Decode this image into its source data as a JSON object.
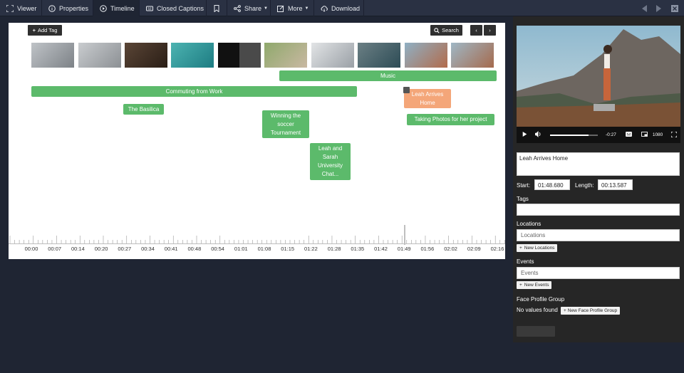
{
  "nav": {
    "tabs": [
      {
        "label": "Viewer",
        "icon": "viewer-icon"
      },
      {
        "label": "Properties",
        "icon": "info-icon"
      },
      {
        "label": "Timeline",
        "icon": "play-circle-icon"
      },
      {
        "label": "Closed Captions",
        "icon": "cc-icon"
      },
      {
        "label": "",
        "icon": "bookmark-icon"
      },
      {
        "label": "Share",
        "icon": "share-icon"
      },
      {
        "label": "More",
        "icon": "edit-icon"
      },
      {
        "label": "Download",
        "icon": "cloud-download-icon"
      }
    ],
    "active_tab": "Timeline"
  },
  "timeline": {
    "add_tag_label": "Add Tag",
    "search_label": "Search",
    "tags": [
      {
        "label": "Music",
        "color": "green"
      },
      {
        "label": "Commuting from Work",
        "color": "green"
      },
      {
        "label": "Leah Arrives Home",
        "color": "orange"
      },
      {
        "label": "The Basilica",
        "color": "green"
      },
      {
        "label": "Winning the soccer Tournament",
        "color": "green"
      },
      {
        "label": "Taking Photos for her project",
        "color": "green"
      },
      {
        "label": "Leah and Sarah University Chat...",
        "color": "green"
      }
    ],
    "ticks": [
      "00:00",
      "00:07",
      "00:14",
      "00:20",
      "00:27",
      "00:34",
      "00:41",
      "00:48",
      "00:54",
      "01:01",
      "01:08",
      "01:15",
      "01:22",
      "01:28",
      "01:35",
      "01:42",
      "01:49",
      "01:56",
      "02:02",
      "02:09",
      "02:16"
    ]
  },
  "player": {
    "time_remaining": "-0:27",
    "quality": "1080",
    "progress": 0.8
  },
  "details": {
    "title_value": "Leah Arrives Home",
    "start_label": "Start:",
    "start_value": "01:48.680",
    "length_label": "Length:",
    "length_value": "00:13.587",
    "tags_label": "Tags",
    "locations_label": "Locations",
    "locations_placeholder": "Locations",
    "new_locations_label": "New Locations",
    "events_label": "Events",
    "events_placeholder": "Events",
    "new_events_label": "New Events",
    "face_group_label": "Face Profile Group",
    "no_values_text": "No values found",
    "new_face_group_label": "New Face Profile Group"
  },
  "colors": {
    "green_tag": "#5cba6b",
    "orange_tag": "#f4a679",
    "background": "#1f2533",
    "panel": "#262626"
  }
}
